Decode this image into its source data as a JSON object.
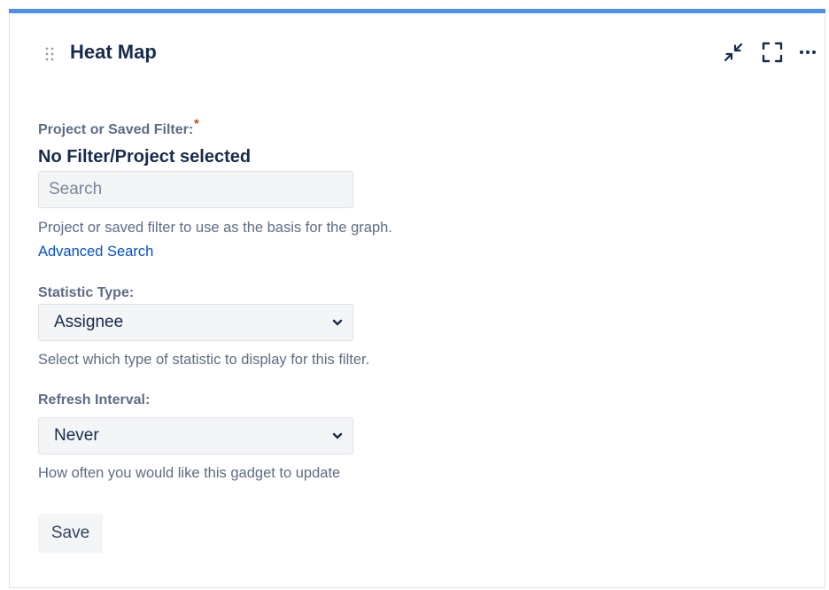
{
  "gadget": {
    "title": "Heat Map",
    "accent_color": "#4c8ff0",
    "actions": [
      "minimize-icon",
      "maximize-icon",
      "more-icon"
    ]
  },
  "form": {
    "project_filter": {
      "label": "Project or Saved Filter:",
      "required_marker": "*",
      "selected_text": "No Filter/Project selected",
      "search_placeholder": "Search",
      "search_value": "",
      "help": "Project or saved filter to use as the basis for the graph.",
      "advanced_link": "Advanced Search"
    },
    "statistic_type": {
      "label": "Statistic Type:",
      "value": "Assignee",
      "help": "Select which type of statistic to display for this filter."
    },
    "refresh_interval": {
      "label": "Refresh Interval:",
      "value": "Never",
      "help": "How often you would like this gadget to update"
    },
    "save_label": "Save"
  }
}
